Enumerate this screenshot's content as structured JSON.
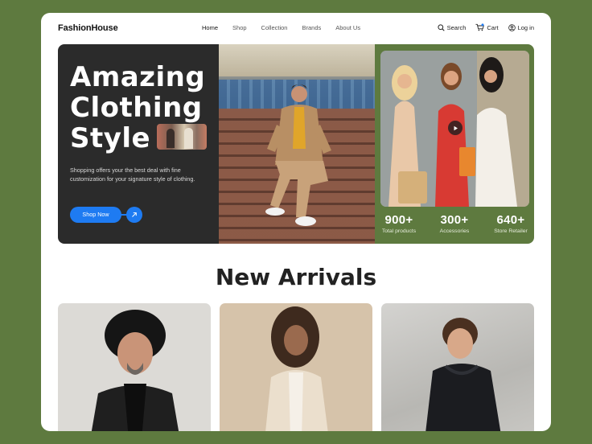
{
  "brand": "FashionHouse",
  "nav": {
    "items": [
      {
        "label": "Home",
        "active": true
      },
      {
        "label": "Shop"
      },
      {
        "label": "Collection"
      },
      {
        "label": "Brands"
      },
      {
        "label": "About Us"
      }
    ],
    "search_label": "Search",
    "cart_label": "Cart",
    "login_label": "Log in"
  },
  "hero": {
    "title_lines": [
      "Amazing",
      "Clothing",
      "Style"
    ],
    "description": "Shopping offers your the best deal with fine customization for your signature style of clothing.",
    "cta_label": "Shop Now",
    "stats": [
      {
        "value": "900+",
        "label": "Total products"
      },
      {
        "value": "300+",
        "label": "Accessories"
      },
      {
        "value": "640+",
        "label": "Store Retailer"
      }
    ]
  },
  "new_arrivals": {
    "title": "New Arrivals",
    "products": [
      {
        "icon": "man-in-black-hat-photo"
      },
      {
        "icon": "woman-in-beige-jacket-photo"
      },
      {
        "icon": "man-in-black-hoodie-photo"
      }
    ]
  },
  "colors": {
    "background": "#5e7a3f",
    "accent": "#1e7bf2",
    "hero_dark": "#2b2b2b"
  }
}
